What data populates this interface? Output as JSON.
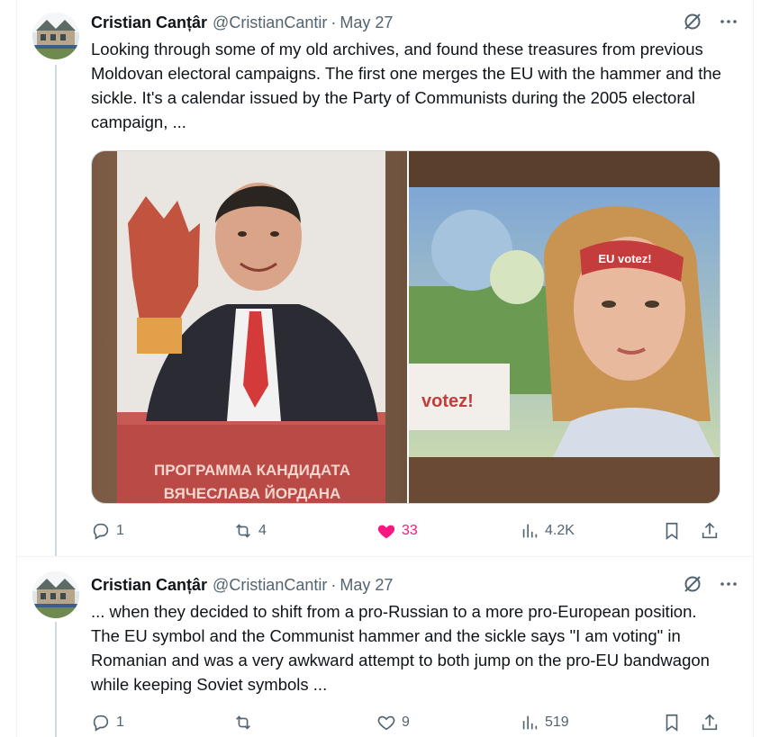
{
  "tweets": [
    {
      "author": {
        "name": "Cristian Canțâr",
        "handle": "@CristianCantir",
        "separator": "·",
        "date": "May 27"
      },
      "text": "Looking through some of my old archives, and found these treasures from previous Moldovan electoral campaigns. The first one merges the EU with the hammer and the sickle. It's a calendar issued by the Party of Communists during the 2005 electoral campaign, ...",
      "media": {
        "left_photo": {
          "caption_line1": "ПРОГРАММА КАНДИДАТА",
          "caption_line2": "ВЯЧЕСЛАВА ЙОРДАНА"
        },
        "right_photo": {
          "headband_text": "EU votez!",
          "sign_text": "votez!"
        }
      },
      "actions": {
        "replies": "1",
        "reposts": "4",
        "likes": "33",
        "views": "4.2K",
        "liked": true
      }
    },
    {
      "author": {
        "name": "Cristian Canțâr",
        "handle": "@CristianCantir",
        "separator": "·",
        "date": "May 27"
      },
      "text": "... when they decided to shift from a pro-Russian to a more pro-European position. The EU symbol and the Communist hammer and the sickle says \"I am voting\" in Romanian and was a very awkward attempt to both jump on the pro-EU bandwagon while keeping Soviet symbols ...",
      "actions": {
        "replies": "1",
        "reposts": "",
        "likes": "9",
        "views": "519",
        "liked": false
      }
    }
  ],
  "icons": {
    "grok": "grok-slash-circle-icon",
    "more": "more-dots-icon",
    "reply": "reply-bubble-icon",
    "repost": "repost-arrows-icon",
    "like": "heart-icon",
    "views": "views-bar-chart-icon",
    "bookmark": "bookmark-icon",
    "share": "share-upload-icon"
  },
  "colors": {
    "like_active": "#f91880",
    "muted": "#536471",
    "text": "#0f1419",
    "thread_line": "#cfd9de"
  }
}
